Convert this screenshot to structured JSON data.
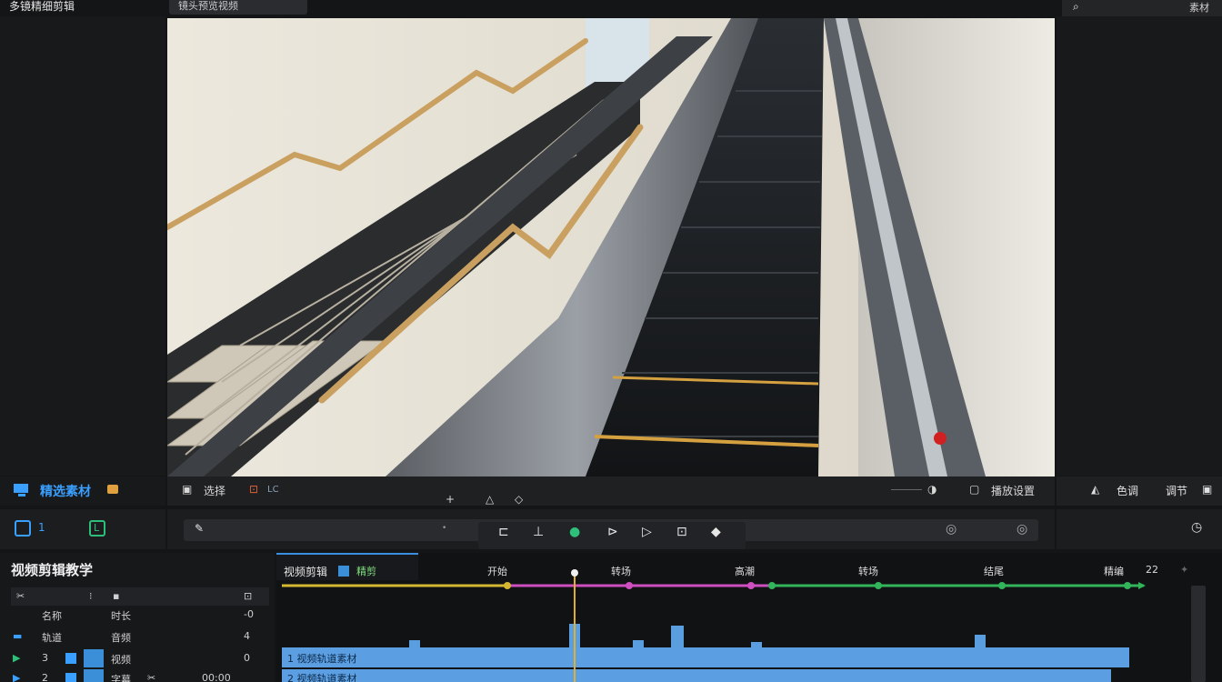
{
  "app": {
    "title": "多镜精细剪辑"
  },
  "viewer": {
    "tab": "镜头预览视频"
  },
  "top_right": {
    "search_icon": "search-icon",
    "label": "素材"
  },
  "library": {
    "title": "精选素材"
  },
  "viewer_tools": {
    "left_label": "选择",
    "mode_label": "LC",
    "center_icons": [
      "+",
      "△",
      "◇"
    ],
    "right_label": "播放设置"
  },
  "right_tools": {
    "label1": "色调",
    "label2": "调节"
  },
  "left_buttons": {
    "b1": "1",
    "b2": "L"
  },
  "transport_controls": [
    "⊏",
    "⊥",
    "●",
    "⊳",
    "▷",
    "⊡",
    "◆"
  ],
  "timeline_panel": {
    "title": "视频剪辑教学",
    "rows": [
      {
        "a": "名称",
        "b": "时长",
        "c": "-0"
      },
      {
        "a": "轨道",
        "b": "音频",
        "c": "4"
      },
      {
        "a": "3",
        "b": "视频",
        "c": "0"
      },
      {
        "a": "2",
        "b": "字幕",
        "c": "00:00"
      }
    ]
  },
  "timeline": {
    "sequence_name": "视频剪辑",
    "sequence_tag": "精剪",
    "counter": "22",
    "marker_labels": [
      "开始",
      "转场",
      "高潮",
      "转场",
      "结尾",
      "精编"
    ],
    "clip_labels": [
      "1 视频轨道素材",
      "2 视频轨道素材"
    ]
  }
}
